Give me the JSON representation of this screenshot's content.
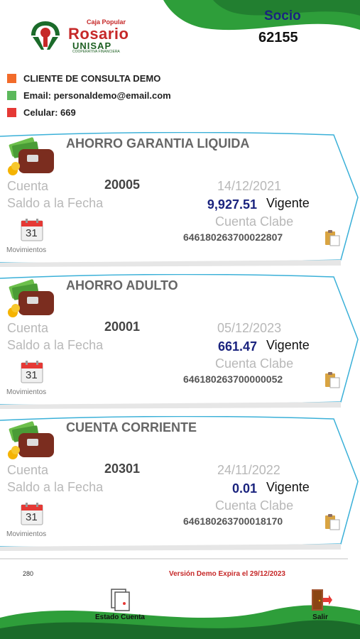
{
  "header": {
    "logo": {
      "small": "Caja Popular",
      "big": "Rosario",
      "sub": "UNISAP",
      "tag": "COOPERATIVA FINANCIERA"
    },
    "socio_label": "Socio",
    "socio_number": "62155"
  },
  "client": {
    "name": "CLIENTE DE CONSULTA DEMO",
    "email": "Email: personaldemo@email.com",
    "phone": "Celular: 669",
    "colors": {
      "name": "#f26b2a",
      "email": "#5cb85c",
      "phone": "#e53935"
    }
  },
  "labels": {
    "cuenta": "Cuenta",
    "saldo": "Saldo a la Fecha",
    "clabe_label": "Cuenta Clabe",
    "movimientos": "Movimientos",
    "calendar_day": "31"
  },
  "accounts": [
    {
      "title": "AHORRO GARANTIA LIQUIDA",
      "number": "20005",
      "date": "14/12/2021",
      "balance": "9,927.51",
      "status": "Vigente",
      "clabe": "646180263700022807"
    },
    {
      "title": "AHORRO ADULTO",
      "number": "20001",
      "date": "05/12/2023",
      "balance": "661.47",
      "status": "Vigente",
      "clabe": "646180263700000052"
    },
    {
      "title": "CUENTA CORRIENTE",
      "number": "20301",
      "date": "24/11/2022",
      "balance": "0.01",
      "status": "Vigente",
      "clabe": "646180263700018170"
    }
  ],
  "footer": {
    "code": "280",
    "version": "Versión Demo Expira el 29/12/2023",
    "estado_label": "Estado Cuenta",
    "salir_label": "Salir"
  },
  "icons": [
    "wallet-money-icon",
    "calendar-icon",
    "clipboard-icon",
    "document-icon",
    "exit-door-icon"
  ],
  "theme": {
    "green": "#2e9e3a",
    "dark_green": "#1b6b2a",
    "navy": "#1a237e",
    "red": "#c62828",
    "card_border": "#3ab0d8"
  }
}
